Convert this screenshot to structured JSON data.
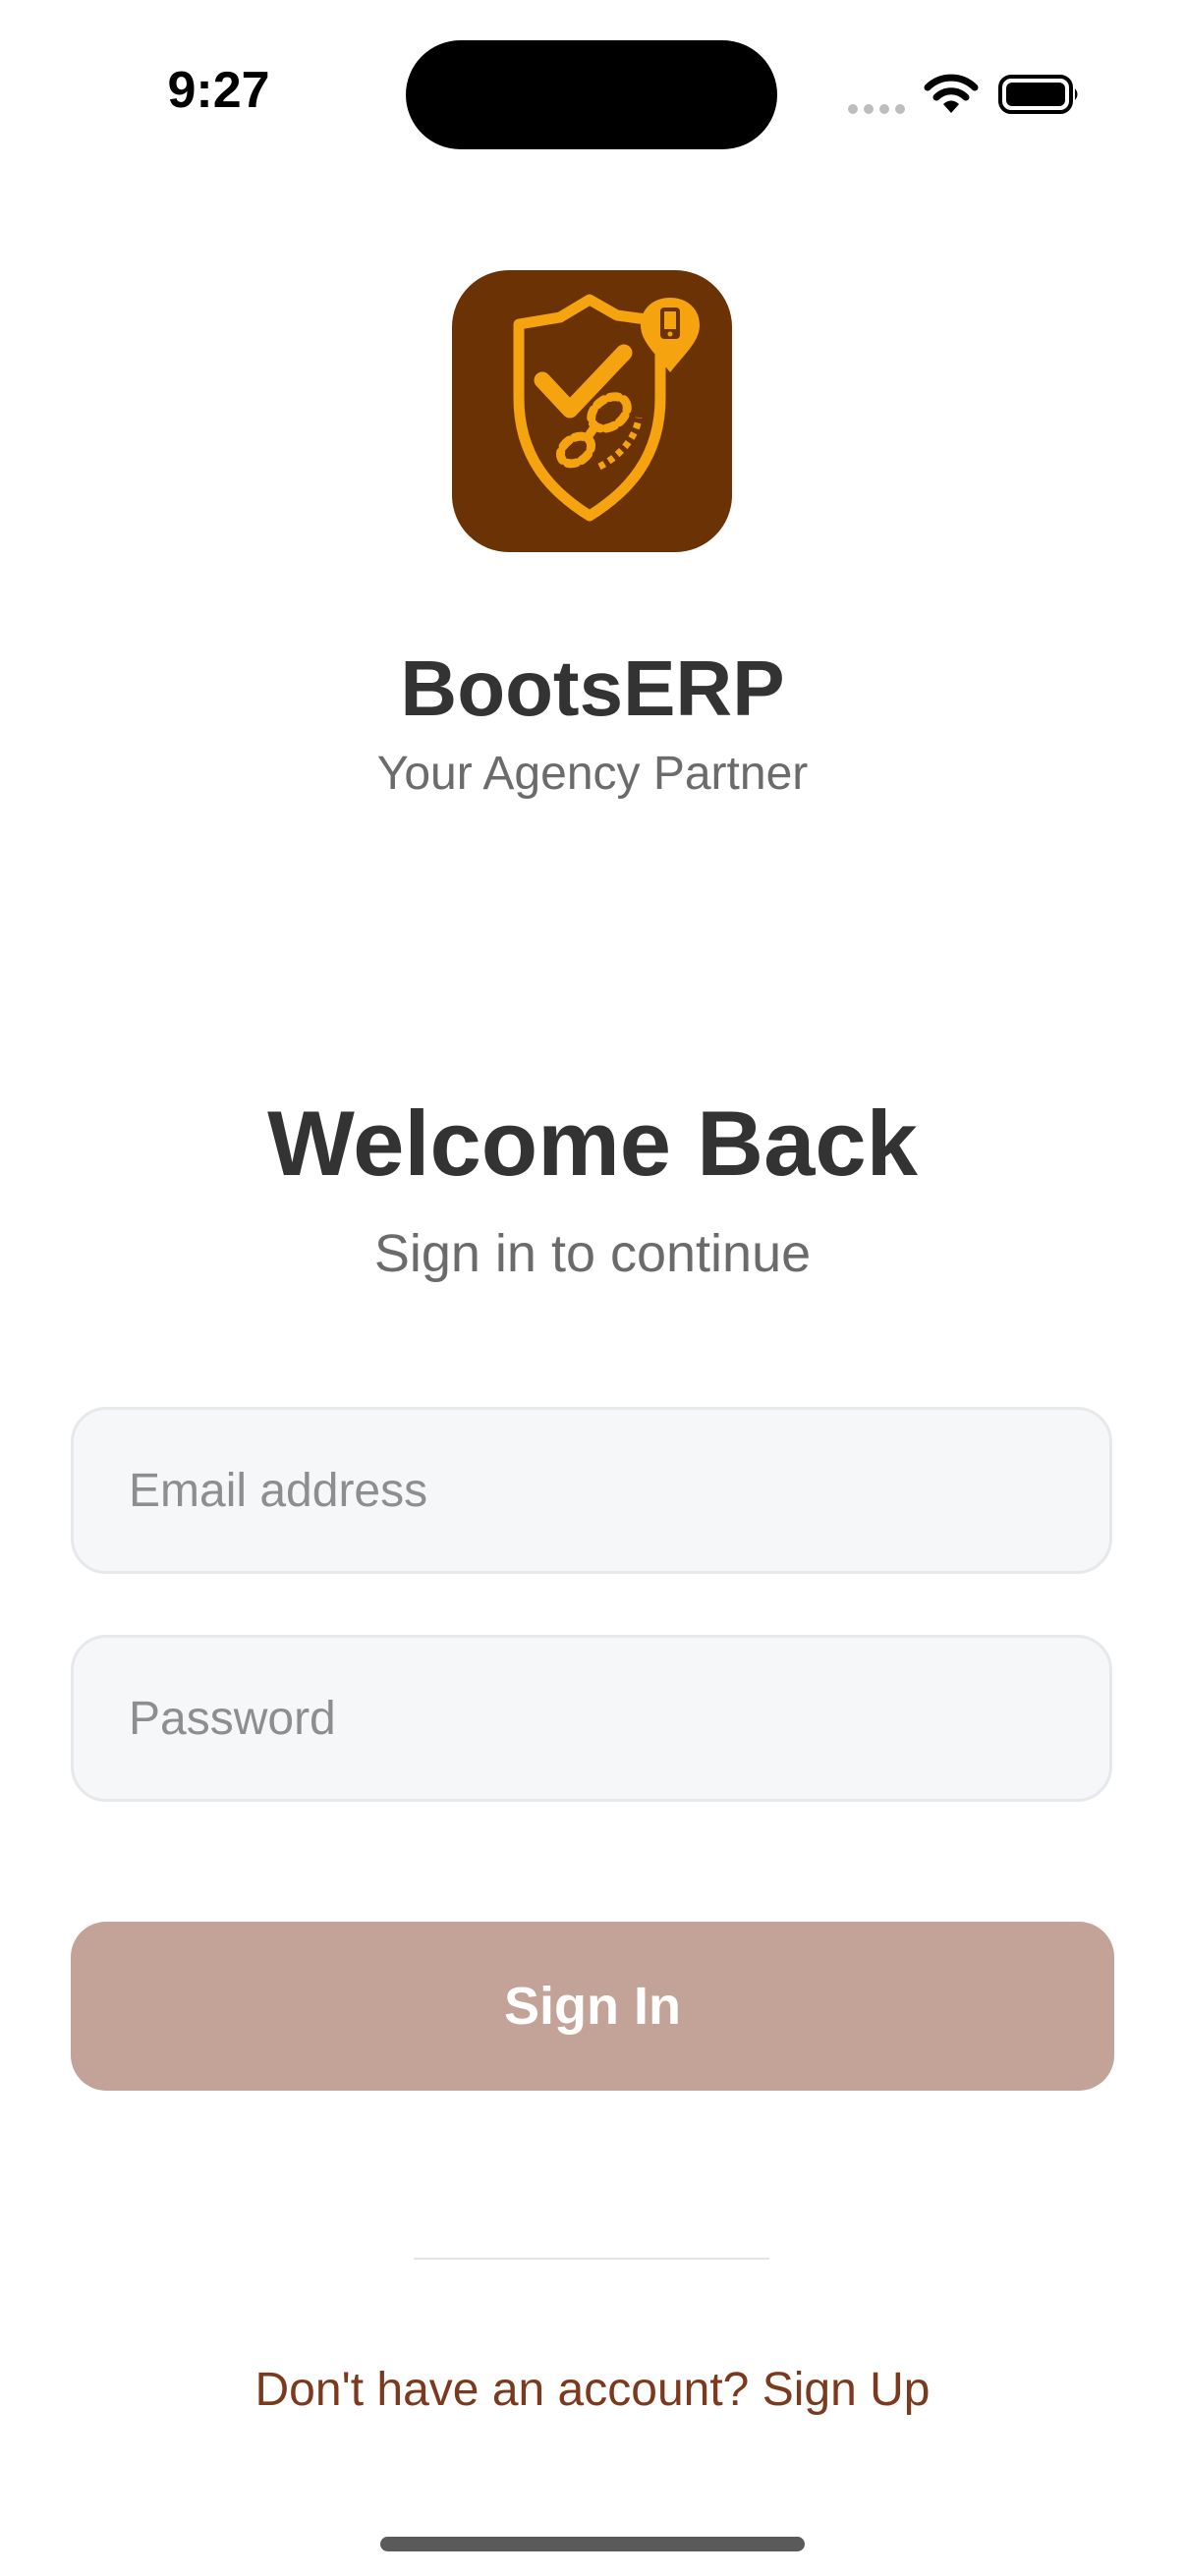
{
  "status_bar": {
    "time": "9:27",
    "icons": [
      "cellular-signal-icon",
      "wifi-icon",
      "battery-icon"
    ]
  },
  "branding": {
    "app_name": "BootsERP",
    "tagline": "Your Agency Partner",
    "logo_icon": "shield-check-bootprint-phone-icon",
    "logo_background": "#6b3205",
    "logo_accent": "#f5a30f"
  },
  "login": {
    "title": "Welcome Back",
    "subtitle": "Sign in to continue",
    "email_placeholder": "Email address",
    "email_value": "",
    "password_placeholder": "Password",
    "password_value": "",
    "sign_in_label": "Sign In",
    "signup_prompt": "Don't have an account? Sign Up"
  },
  "colors": {
    "button_background": "#c3a298",
    "link": "#7b3a1d",
    "input_background": "#f6f7f9"
  }
}
